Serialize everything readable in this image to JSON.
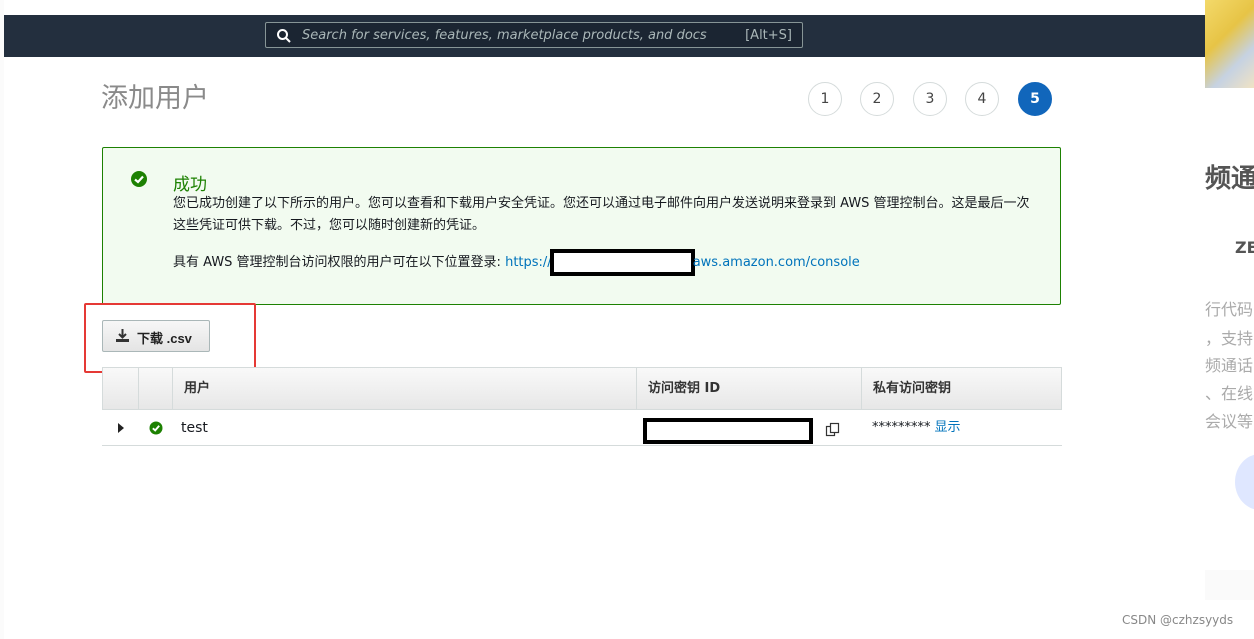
{
  "search": {
    "placeholder": "Search for services, features, marketplace products, and docs",
    "shortcut": "[Alt+S]"
  },
  "page": {
    "title": "添加用户"
  },
  "steps": [
    "1",
    "2",
    "3",
    "4",
    "5"
  ],
  "active_step": "5",
  "alert": {
    "title": "成功",
    "message": "您已成功创建了以下所示的用户。您可以查看和下载用户安全凭证。您还可以通过电子邮件向用户发送说明来登录到 AWS 管理控制台。这是最后一次这些凭证可供下载。不过，您可以随时创建新的凭证。",
    "login_prefix": "具有 AWS 管理控制台访问权限的用户可在以下位置登录: ",
    "login_link_start": "https://",
    "login_link_end": "aws.amazon.com/console"
  },
  "download_button": {
    "label": "下载 .csv"
  },
  "table": {
    "headers": {
      "user": "用户",
      "access_key": "访问密钥 ID",
      "secret_key": "私有访问密钥"
    },
    "rows": [
      {
        "user": "test",
        "secret_masked": "*********",
        "show_label": "显示"
      }
    ]
  },
  "side_panel": {
    "heading": "频通",
    "sub": "ZE",
    "lines": [
      "行代码",
      "，支持",
      "频通话",
      "、在线",
      "会议等"
    ]
  },
  "watermark": "CSDN @czhzsyyds",
  "colors": {
    "topbar": "#232f3e",
    "success": "#1d8102",
    "link": "#0073bb",
    "active_step": "#1166bb",
    "highlight": "#e53935"
  }
}
